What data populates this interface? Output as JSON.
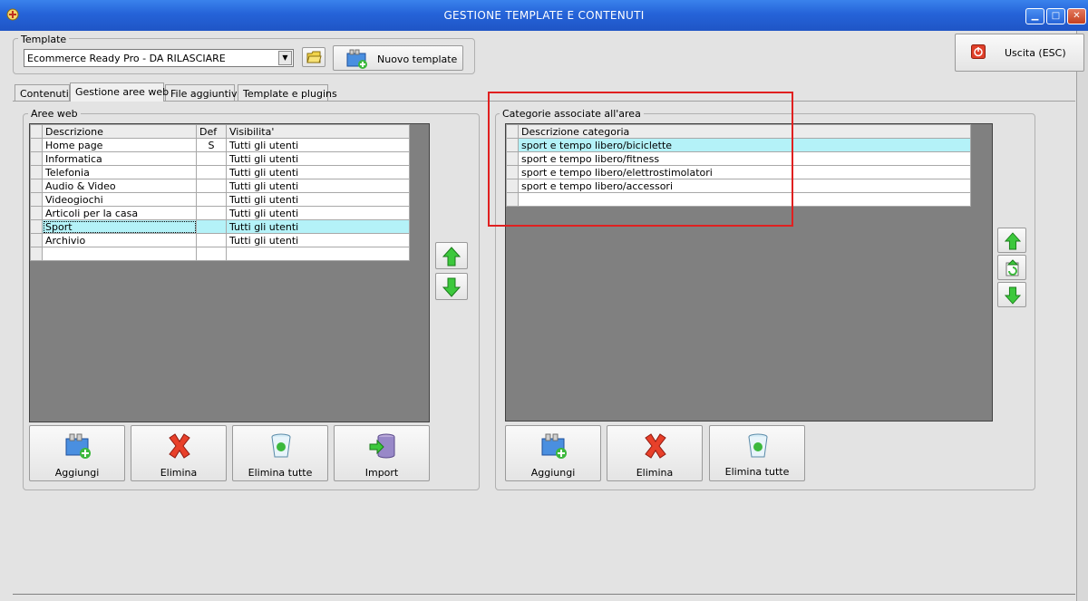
{
  "window": {
    "title": "GESTIONE TEMPLATE E CONTENUTI"
  },
  "template": {
    "group_label": "Template",
    "selected": "Ecommerce Ready Pro - DA RILASCIARE",
    "new_button": "Nuovo template"
  },
  "exit_button": "Uscita (ESC)",
  "tabs": [
    {
      "label": "Contenuti"
    },
    {
      "label": "Gestione aree web"
    },
    {
      "label": "File aggiuntivi"
    },
    {
      "label": "Template e plugins"
    }
  ],
  "aree": {
    "group_label": "Aree web",
    "columns": [
      "Descrizione",
      "Def",
      "Visibilita'"
    ],
    "rows": [
      {
        "desc": "Home page",
        "def": "S",
        "vis": "Tutti gli utenti"
      },
      {
        "desc": "Informatica",
        "def": "",
        "vis": "Tutti gli utenti"
      },
      {
        "desc": "Telefonia",
        "def": "",
        "vis": "Tutti gli utenti"
      },
      {
        "desc": "Audio & Video",
        "def": "",
        "vis": "Tutti gli utenti"
      },
      {
        "desc": "Videogiochi",
        "def": "",
        "vis": "Tutti gli utenti"
      },
      {
        "desc": "Articoli per la casa",
        "def": "",
        "vis": "Tutti gli utenti"
      },
      {
        "desc": "Sport",
        "def": "",
        "vis": "Tutti gli utenti"
      },
      {
        "desc": "Archivio",
        "def": "",
        "vis": "Tutti gli utenti"
      }
    ],
    "buttons": {
      "add": "Aggiungi",
      "delete": "Elimina",
      "delete_all": "Elimina tutte",
      "import": "Import"
    }
  },
  "categorie": {
    "group_label": "Categorie associate all'area",
    "column": "Descrizione categoria",
    "rows": [
      "sport e tempo libero/biciclette",
      "sport e tempo libero/fitness",
      "sport e tempo libero/elettrostimolatori",
      "sport e tempo libero/accessori"
    ],
    "buttons": {
      "add": "Aggiungi",
      "delete": "Elimina",
      "delete_all": "Elimina tutte"
    }
  },
  "colors": {
    "titlebar": "#2563d8",
    "selected_row": "#b4f2f8",
    "highlight_box": "#e02020",
    "grid_bg": "#808080"
  }
}
